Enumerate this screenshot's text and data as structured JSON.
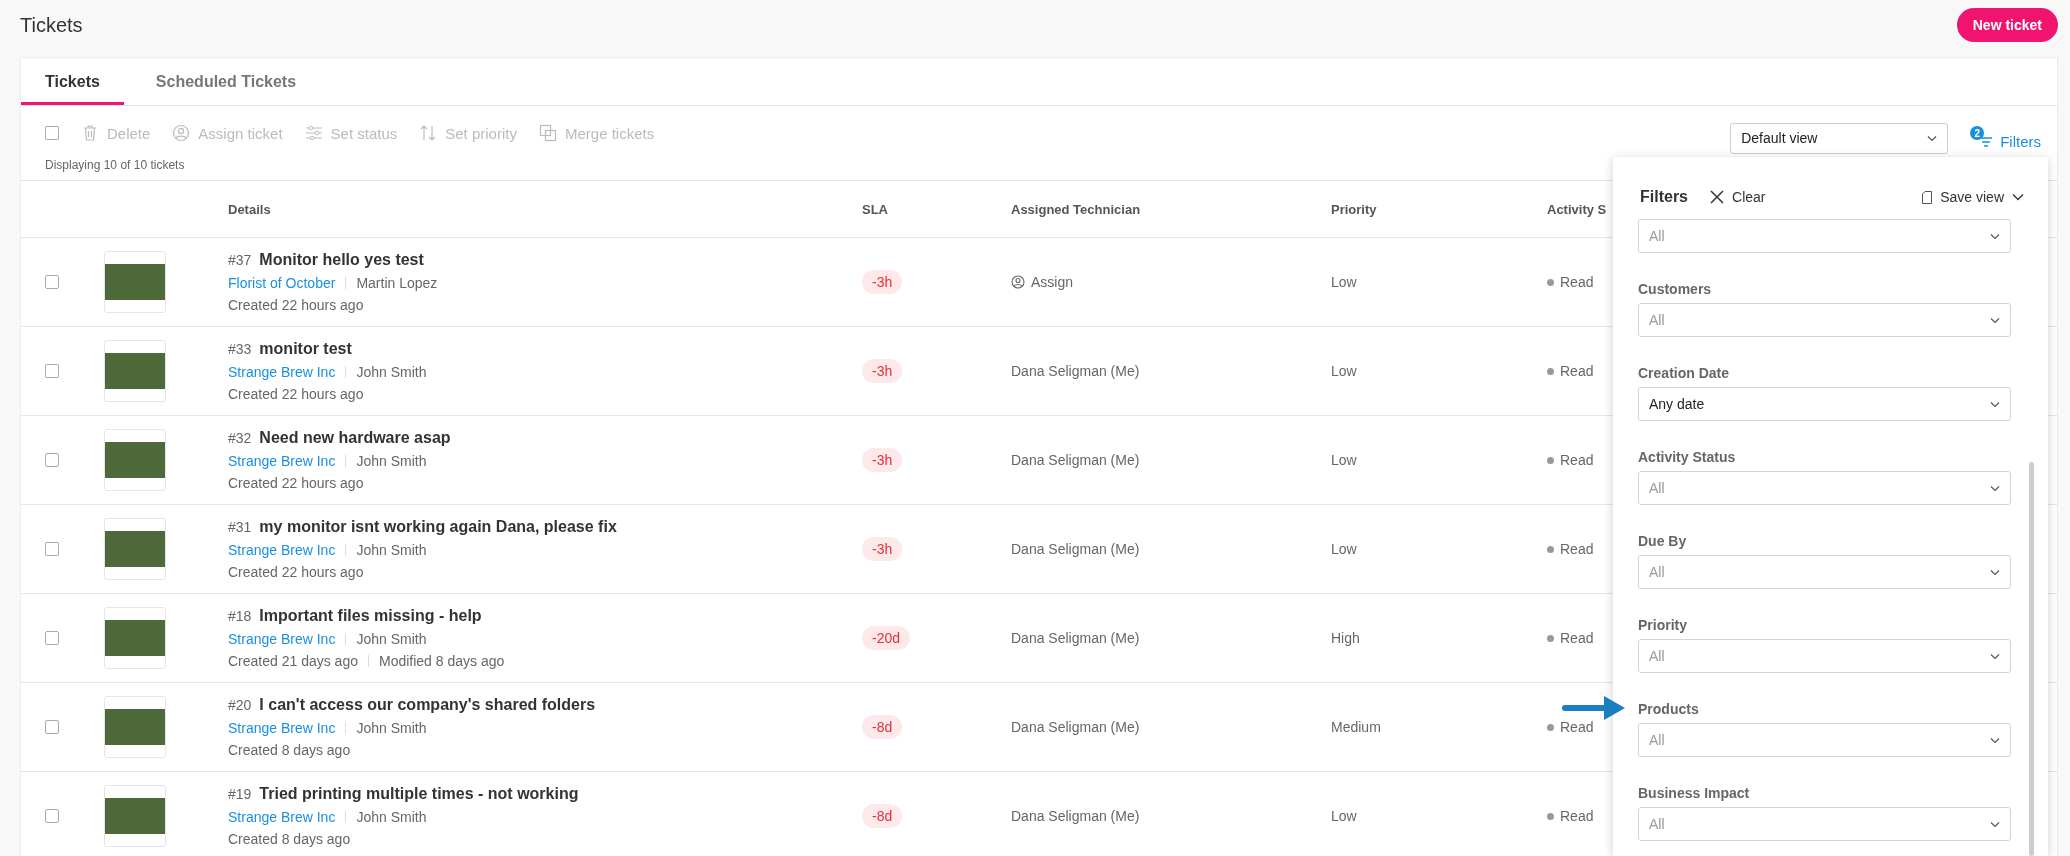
{
  "page": {
    "title": "Tickets",
    "new_ticket_button": "New ticket"
  },
  "tabs": [
    {
      "label": "Tickets",
      "selected": true
    },
    {
      "label": "Scheduled Tickets",
      "selected": false
    }
  ],
  "toolbar": {
    "select_all": {
      "checked": false
    },
    "actions": [
      {
        "kind": "delete",
        "label": "Delete",
        "disabled": true
      },
      {
        "kind": "assign",
        "label": "Assign ticket",
        "disabled": true
      },
      {
        "kind": "status",
        "label": "Set status",
        "disabled": true
      },
      {
        "kind": "priority",
        "label": "Set priority",
        "disabled": true
      },
      {
        "kind": "merge",
        "label": "Merge tickets",
        "disabled": true
      }
    ],
    "summary": "Displaying 10 of 10 tickets",
    "view_select": {
      "value": "Default view"
    },
    "filters_button": {
      "label": "Filters",
      "badge": "2"
    }
  },
  "table": {
    "columns": [
      "Details",
      "SLA",
      "Assigned Technician",
      "Priority",
      "Activity S"
    ],
    "rows": [
      {
        "checked": false,
        "number": "#37",
        "title": "Monitor hello yes test",
        "customer": "Florist of October",
        "contact": "Martin Lopez",
        "created": "Created 22 hours ago",
        "sla": "-3h",
        "technician": {
          "kind": "assign",
          "label": "Assign"
        },
        "priority": "Low",
        "activity": "Read"
      },
      {
        "checked": false,
        "number": "#33",
        "title": "monitor test",
        "customer": "Strange Brew Inc",
        "contact": "John Smith",
        "created": "Created 22 hours ago",
        "sla": "-3h",
        "technician": {
          "kind": "name",
          "label": "Dana Seligman (Me)"
        },
        "priority": "Low",
        "activity": "Read"
      },
      {
        "checked": false,
        "number": "#32",
        "title": "Need new hardware asap",
        "customer": "Strange Brew Inc",
        "contact": "John Smith",
        "created": "Created 22 hours ago",
        "sla": "-3h",
        "technician": {
          "kind": "name",
          "label": "Dana Seligman (Me)"
        },
        "priority": "Low",
        "activity": "Read"
      },
      {
        "checked": false,
        "number": "#31",
        "title": "my monitor isnt working again Dana, please fix",
        "customer": "Strange Brew Inc",
        "contact": "John Smith",
        "created": "Created 22 hours ago",
        "sla": "-3h",
        "technician": {
          "kind": "name",
          "label": "Dana Seligman (Me)"
        },
        "priority": "Low",
        "activity": "Read"
      },
      {
        "checked": false,
        "number": "#18",
        "title": "Important files missing - help",
        "customer": "Strange Brew Inc",
        "contact": "John Smith",
        "created": "Created 21 days ago",
        "modified": "Modified 8 days ago",
        "sla": "-20d",
        "technician": {
          "kind": "name",
          "label": "Dana Seligman (Me)"
        },
        "priority": "High",
        "activity": "Read"
      },
      {
        "checked": false,
        "number": "#20",
        "title": "I can't access our company's shared folders",
        "customer": "Strange Brew Inc",
        "contact": "John Smith",
        "created": "Created 8 days ago",
        "sla": "-8d",
        "technician": {
          "kind": "name",
          "label": "Dana Seligman (Me)"
        },
        "priority": "Medium",
        "activity": "Read"
      },
      {
        "checked": false,
        "number": "#19",
        "title": "Tried printing multiple times - not working",
        "customer": "Strange Brew Inc",
        "contact": "John Smith",
        "created": "Created 8 days ago",
        "sla": "-8d",
        "technician": {
          "kind": "name",
          "label": "Dana Seligman (Me)"
        },
        "priority": "Low",
        "activity": "Read"
      }
    ]
  },
  "filters_panel": {
    "title": "Filters",
    "clear": "Clear",
    "save_view": "Save view",
    "fields": [
      {
        "placeholder": "All"
      },
      {
        "label": "Customers",
        "placeholder": "All"
      },
      {
        "label": "Creation Date",
        "value": "Any date"
      },
      {
        "label": "Activity Status",
        "placeholder": "All"
      },
      {
        "label": "Due By",
        "placeholder": "All"
      },
      {
        "label": "Priority",
        "placeholder": "All"
      },
      {
        "label": "Products",
        "placeholder": "All"
      },
      {
        "label": "Business Impact",
        "placeholder": "All"
      }
    ]
  }
}
